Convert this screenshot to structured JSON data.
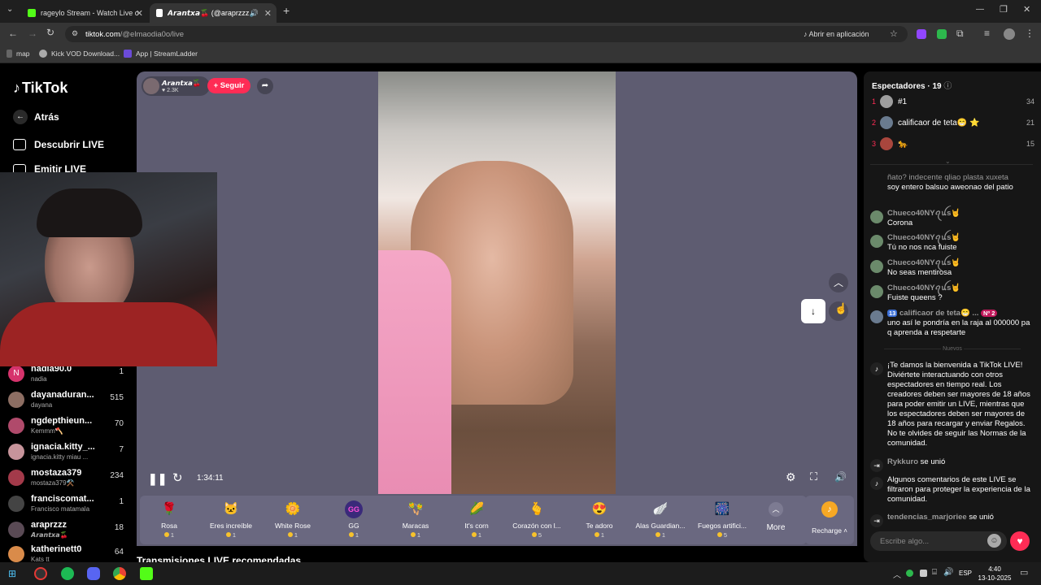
{
  "browser": {
    "tabs": [
      {
        "title": "rageylo Stream - Watch Live on"
      },
      {
        "title": "𝘼𝙧𝙖𝙣𝙩𝙭𝙖🍒 (@araprzzz) e"
      }
    ],
    "url_host": "tiktok.com",
    "url_path": "/@elmaodia0o/live",
    "open_in_app": "Abrir en aplicación",
    "bookmarks": [
      "map",
      "Kick VOD Download...",
      "App | StreamLadder"
    ]
  },
  "sidebar": {
    "logo": "TikTok",
    "back": "Atrás",
    "discover": "Descubrir LIVE",
    "go_live": "Emitir LIVE",
    "users": [
      {
        "name": "nadia90.0",
        "sub": "nadia",
        "count": "1",
        "letter": "N"
      },
      {
        "name": "dayanaduran...",
        "sub": "dayana",
        "count": "515"
      },
      {
        "name": "ngdepthieun...",
        "sub": "Kemmm🪓",
        "count": "70"
      },
      {
        "name": "ignacia.kitty_...",
        "sub": "ignacia.kitty miau ...",
        "count": "7"
      },
      {
        "name": "mostaza379",
        "sub": "mostaza379⚒️",
        "count": "234"
      },
      {
        "name": "franciscomat...",
        "sub": "Francisco matamala",
        "count": "1"
      },
      {
        "name": "araprzzz",
        "sub": "𝘼𝙧𝙖𝙣𝙩𝙭𝙖🍒",
        "count": "18"
      },
      {
        "name": "katherinett0",
        "sub": "Kats tt",
        "count": "64"
      }
    ]
  },
  "player": {
    "host_name": "𝘼𝙧𝙖𝙣𝙩𝙭𝙖🍒",
    "host_likes": "2.3K",
    "follow": "+ Seguir",
    "time": "1:34:11"
  },
  "gifts": [
    {
      "name": "Rosa",
      "price": "1",
      "icon": "🌹"
    },
    {
      "name": "Eres increíble",
      "price": "1",
      "icon": "🐱"
    },
    {
      "name": "White Rose",
      "price": "1",
      "icon": "🌼"
    },
    {
      "name": "GG",
      "price": "1",
      "icon": "GG"
    },
    {
      "name": "Maracas",
      "price": "1",
      "icon": "🪇"
    },
    {
      "name": "It's corn",
      "price": "1",
      "icon": "🌽"
    },
    {
      "name": "Corazón con l...",
      "price": "5",
      "icon": "🫰"
    },
    {
      "name": "Te adoro",
      "price": "1",
      "icon": "😍"
    },
    {
      "name": "Alas Guardian...",
      "price": "1",
      "icon": "🪽"
    },
    {
      "name": "Fuegos artifici...",
      "price": "5",
      "icon": "🎆"
    }
  ],
  "gift_more": "More",
  "recharge": "Recharge",
  "recommended": "Transmisiones LIVE recomendadas",
  "chat": {
    "viewers_label": "Espectadores · 19",
    "top": [
      {
        "rank": "1",
        "name": "#1",
        "count": "34"
      },
      {
        "rank": "2",
        "name": "calificaor de teta😁 ⭐",
        "count": "21"
      },
      {
        "rank": "3",
        "name": "🐆",
        "count": "15"
      }
    ],
    "partial_top": "ñato? indecente qliao plasta xuxeta",
    "messages": [
      {
        "name": "",
        "text": "soy entero balsuo aweonao del patio"
      },
      {
        "name": "Chueco40NYꪖꪊs🤘",
        "text": "Corona"
      },
      {
        "name": "Chueco40NYꪖꪊs🤘",
        "text": "Tú no nos nca fuiste"
      },
      {
        "name": "Chueco40NYꪖꪊs🤘",
        "text": "No seas mentirosa"
      },
      {
        "name": "Chueco40NYꪖꪊs🤘",
        "text": "Fuiste queens ?"
      },
      {
        "name": "calificaor de teta😁 ...",
        "badge": "13",
        "badge2": "Nº 2",
        "text": "uno así le pondría en la raja al 000000 pa q aprenda a respetarte"
      }
    ],
    "new_label": "Nuevos",
    "welcome": "¡Te damos la bienvenida a TikTok LIVE! Diviértete interactuando con otros espectadores en tiempo real. Los creadores deben ser mayores de 18 años para poder emitir un LIVE, mientras que los espectadores deben ser mayores de 18 años para recargar y enviar Regalos. No te olvides de seguir las Normas de la comunidad.",
    "join1_name": "Rykkuro",
    "join_text": "se unió",
    "filter_note": "Algunos comentarios de este LIVE se filtraron para proteger la experiencia de la comunidad.",
    "join2_name": "tendencias_marjoriee",
    "input_placeholder": "Escribe algo..."
  },
  "taskbar": {
    "lang": "ESP",
    "time": "4:40",
    "date": "13-10-2025"
  },
  "colors": {
    "accent": "#fe2c55",
    "player_bg": "#5e5c71"
  }
}
